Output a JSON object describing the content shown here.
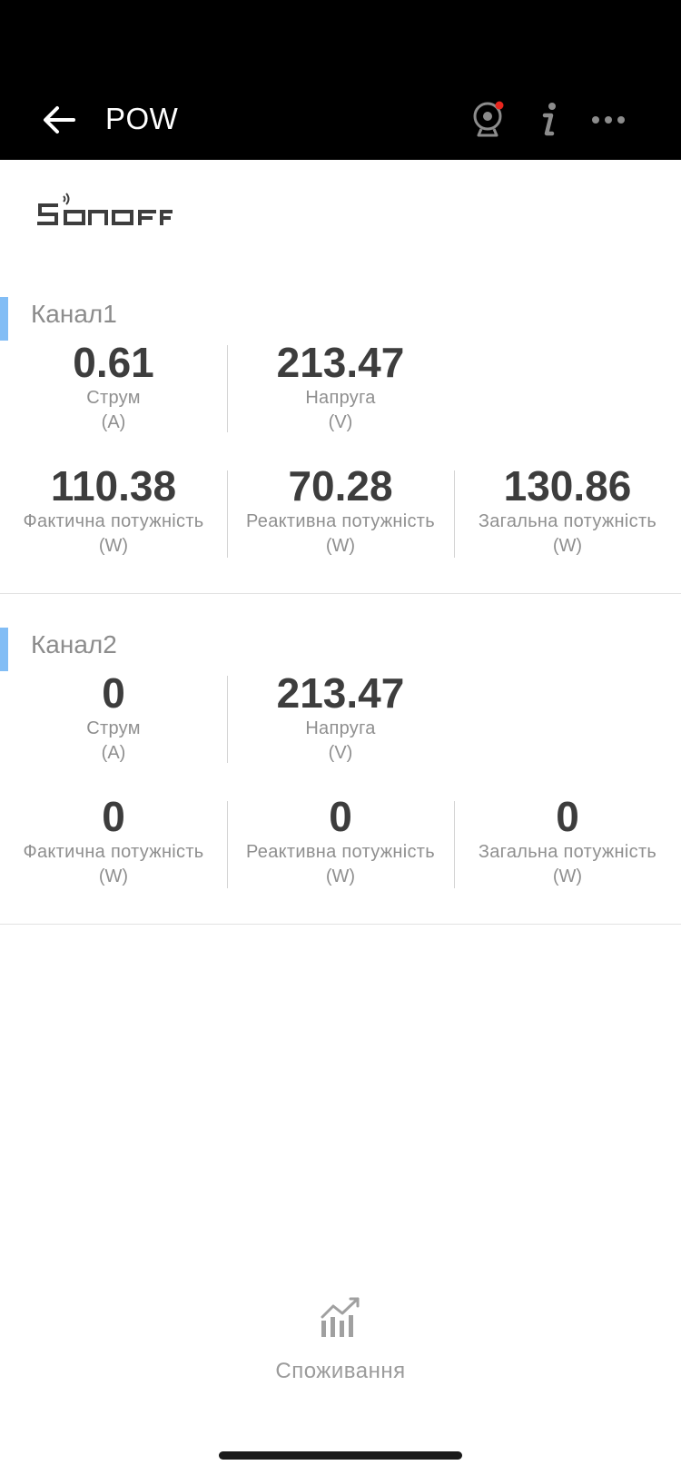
{
  "header": {
    "title": "POW",
    "icons": {
      "back": "arrow-left-icon",
      "camera": "camera-icon",
      "info": "info-icon",
      "more": "more-horizontal-icon"
    },
    "colors": {
      "background": "#000000",
      "text": "#ffffff",
      "camera_dot": "#e8261e"
    }
  },
  "brand": {
    "logo_text": "SONOFF"
  },
  "channels": [
    {
      "title": "Канал1",
      "current": {
        "value": "0.61",
        "label": "Струм",
        "unit": "(A)"
      },
      "voltage": {
        "value": "213.47",
        "label": "Напруга",
        "unit": "(V)"
      },
      "active_power": {
        "value": "110.38",
        "label": "Фактична потужність",
        "unit": "(W)"
      },
      "reactive_power": {
        "value": "70.28",
        "label": "Реактивна потужність",
        "unit": "(W)"
      },
      "apparent_power": {
        "value": "130.86",
        "label": "Загальна потужність",
        "unit": "(W)"
      }
    },
    {
      "title": "Канал2",
      "current": {
        "value": "0",
        "label": "Струм",
        "unit": "(A)"
      },
      "voltage": {
        "value": "213.47",
        "label": "Напруга",
        "unit": "(V)"
      },
      "active_power": {
        "value": "0",
        "label": "Фактична потужність",
        "unit": "(W)"
      },
      "reactive_power": {
        "value": "0",
        "label": "Реактивна потужність",
        "unit": "(W)"
      },
      "apparent_power": {
        "value": "0",
        "label": "Загальна потужність",
        "unit": "(W)"
      }
    }
  ],
  "footer": {
    "consumption_label": "Споживання",
    "consumption_icon": "chart-bars-icon"
  },
  "colors": {
    "accent_marker": "#82bdf5",
    "value_text": "#3d3d3d",
    "label_text": "#8f8f8f"
  }
}
